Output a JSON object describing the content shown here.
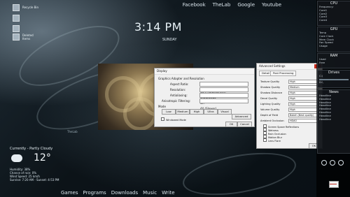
{
  "desktop": {
    "icons": [
      {
        "label": "Recycle Bin"
      },
      {
        "label": ""
      },
      {
        "label": ""
      },
      {
        "label": "Deleted Items"
      }
    ],
    "top_nav": [
      "Facebook",
      "TheLab",
      "Google",
      "Youtube"
    ],
    "clock": {
      "time": "3:14 PM",
      "day": "SUNDAY"
    },
    "watermark": "TheLab",
    "bottom_menu": [
      "Games",
      "Programs",
      "Downloads",
      "Music",
      "Write"
    ]
  },
  "weather": {
    "condition": "Currently - Partly Cloudy",
    "temperature": "12°",
    "details": [
      "Humidity: 38%",
      "Chance of rain: 0%",
      "Wind Speed: 25 km/h",
      "Sunrise: 7:20 AM - Sunset: 4:53 PM"
    ]
  },
  "right_panel": {
    "cpu": {
      "title": "CPU",
      "lines": [
        "Frequency:",
        "Core1",
        "Core2",
        "Core3",
        "Core4"
      ]
    },
    "gpu": {
      "title": "GPU",
      "lines": [
        "Temp",
        "Core Clock",
        "Mem Clock",
        "Fan Speed",
        "Usage"
      ]
    },
    "ram": {
      "title": "RAM",
      "lines": [
        "Used",
        "Free"
      ]
    },
    "drives": {
      "title": "Drives",
      "lines": [
        "C:\\",
        "D:\\"
      ]
    },
    "news": {
      "title": "News",
      "lines": [
        "Headline",
        "Headline",
        "Headline",
        "Headline",
        "Headline",
        "Headline",
        "Headline",
        "Headline"
      ]
    }
  },
  "dialog_display": {
    "title": "Display",
    "group_title": "Graphics Adapter and Resolution",
    "labels": [
      "Aspect Ratio:",
      "Resolution:",
      "Antialiasing:",
      "Anisotropic Filtering:"
    ],
    "values": [
      "16:9 (Widescreen)",
      "1920x1080",
      "Off",
      "4X (Slower)"
    ],
    "mode_title": "Mode",
    "mode_buttons": [
      "Low",
      "Medium",
      "High",
      "Ultra",
      "Visual"
    ],
    "advanced_label": "Advanced",
    "windowed_label": "Windowed Mode",
    "ok": "OK",
    "cancel": "Cancel"
  },
  "dialog_advanced": {
    "title": "Advanced Settings",
    "tabs": [
      "Detail",
      "Post Processing"
    ],
    "settings": [
      {
        "name": "Texture Quality",
        "value": "High"
      },
      {
        "name": "Shadow Quality",
        "value": "Medium"
      },
      {
        "name": "Shadow Distance",
        "value": "High"
      },
      {
        "name": "Decal Quality",
        "value": "High"
      },
      {
        "name": "Lighting Quality",
        "value": "High"
      },
      {
        "name": "Volume Quality",
        "value": "High"
      },
      {
        "name": "Depth of Field",
        "value": "Bokeh (Best quality)"
      },
      {
        "name": "Ambient Occlusion",
        "value": "HDAO"
      }
    ],
    "checks": [
      "Screen Space Reflections",
      "Wetness",
      "Rain Occlusion",
      "Motion Blur",
      "Lens Flare"
    ],
    "ok": "OK"
  },
  "colors": {
    "accent": "#8aa8b9",
    "dark_panel": "#0b0f12",
    "window_bg": "#f0f0f0",
    "close_red": "#c42b1c"
  }
}
